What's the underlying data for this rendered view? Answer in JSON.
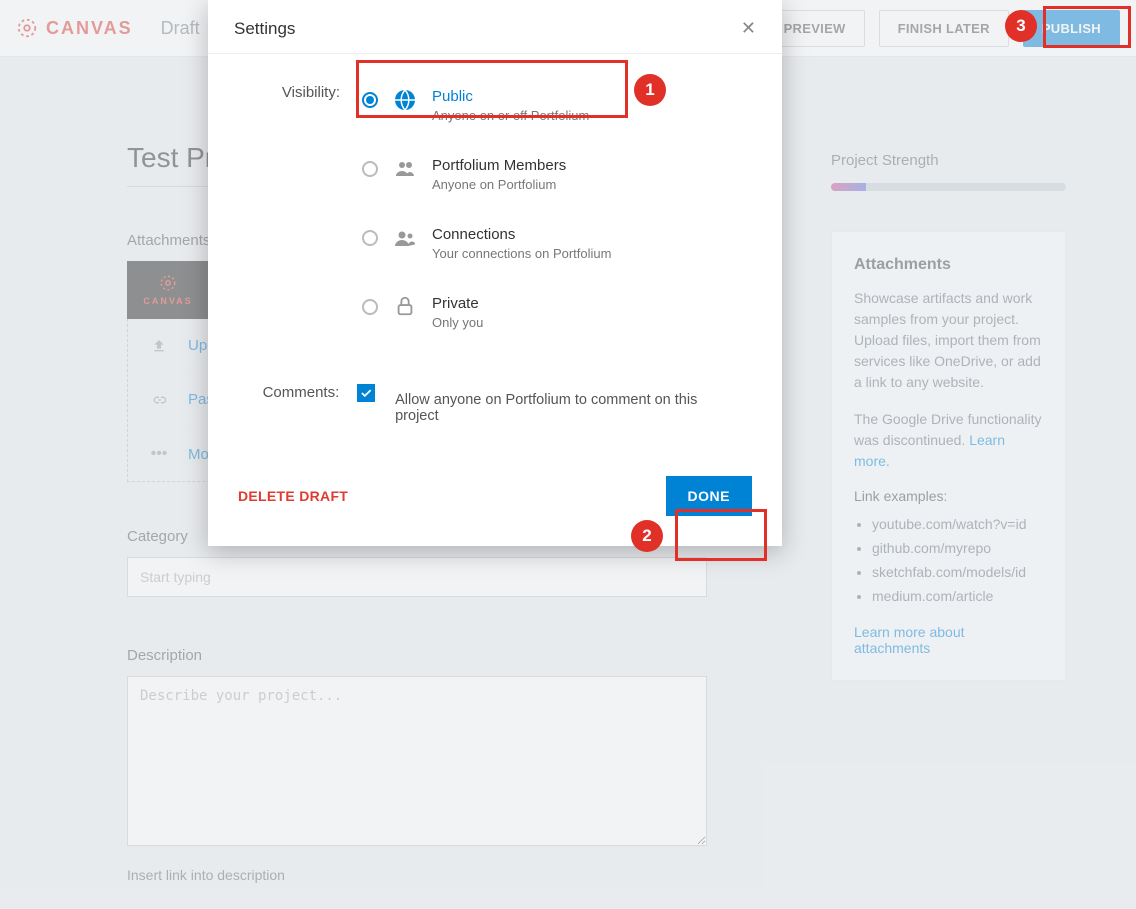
{
  "header": {
    "logo_text": "CANVAS",
    "draft_label": "Draft",
    "preview": "PREVIEW",
    "finish_later": "FINISH LATER",
    "publish": "PUBLISH"
  },
  "project": {
    "title": "Test Project",
    "attachments_label": "Attachments",
    "actions": {
      "upload": "Upload",
      "paste": "Paste",
      "more": "More"
    },
    "category_label": "Category",
    "category_placeholder": "Start typing",
    "description_label": "Description",
    "description_placeholder": "Describe your project...",
    "insert_link": "Insert link into description"
  },
  "sidebar": {
    "strength_label": "Project Strength",
    "card_title": "Attachments",
    "card_p1": "Showcase artifacts and work samples from your project. Upload files, import them from services like OneDrive, or add a link to any website.",
    "card_p2": "The Google Drive functionality was discontinued. ",
    "learn_more_inline": "Learn more.",
    "examples_label": "Link examples:",
    "examples": [
      "youtube.com/watch?v=id",
      "github.com/myrepo",
      "sketchfab.com/models/id",
      "medium.com/article"
    ],
    "learn_more": "Learn more about attachments"
  },
  "modal": {
    "title": "Settings",
    "visibility_label": "Visibility:",
    "options": [
      {
        "title": "Public",
        "desc": "Anyone on or off Portfolium",
        "icon": "globe",
        "selected": true
      },
      {
        "title": "Portfolium Members",
        "desc": "Anyone on Portfolium",
        "icon": "members",
        "selected": false
      },
      {
        "title": "Connections",
        "desc": "Your connections on Portfolium",
        "icon": "group",
        "selected": false
      },
      {
        "title": "Private",
        "desc": "Only you",
        "icon": "lock",
        "selected": false
      }
    ],
    "comments_label": "Comments:",
    "comments_check_label": "Allow anyone on Portfolium to comment on this project",
    "delete_draft": "DELETE DRAFT",
    "done": "DONE"
  },
  "callouts": {
    "1": "1",
    "2": "2",
    "3": "3"
  }
}
